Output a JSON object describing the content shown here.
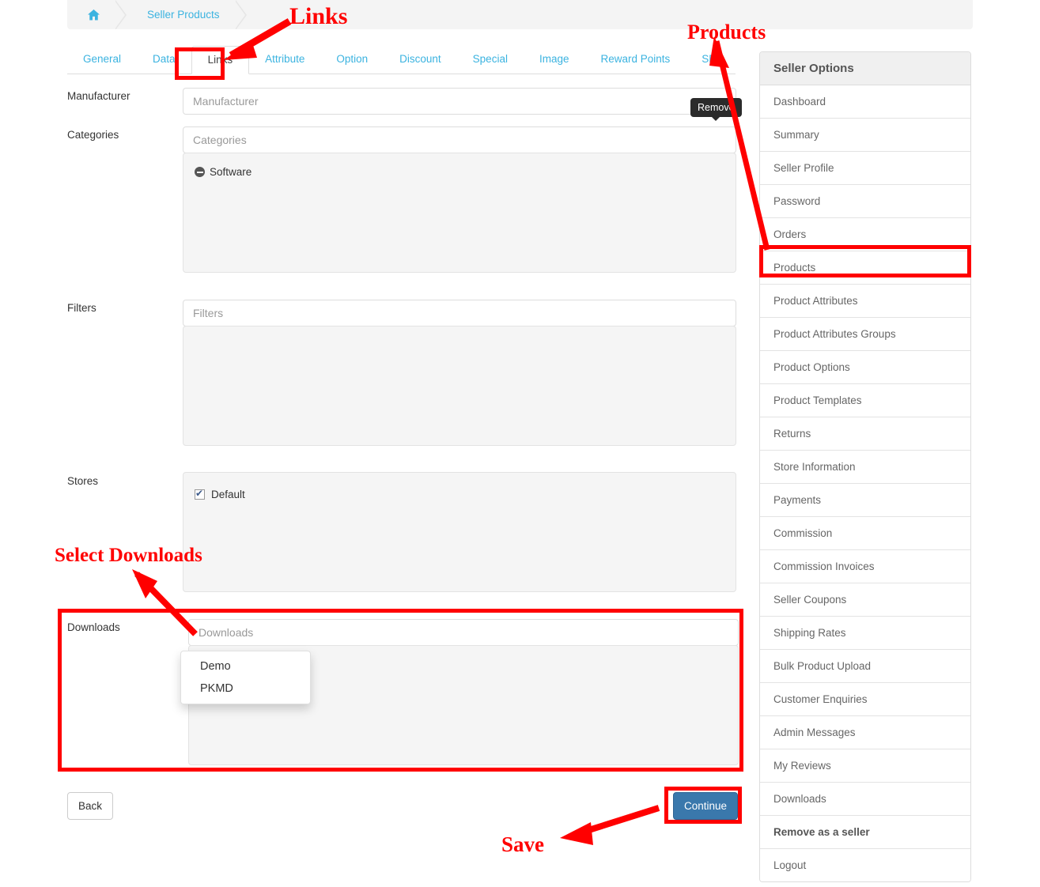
{
  "breadcrumb": {
    "home_icon": "home-icon",
    "items": [
      "Seller Products"
    ]
  },
  "tabs": [
    {
      "label": "General",
      "active": false
    },
    {
      "label": "Data",
      "active": false
    },
    {
      "label": "Links",
      "active": true
    },
    {
      "label": "Attribute",
      "active": false
    },
    {
      "label": "Option",
      "active": false
    },
    {
      "label": "Discount",
      "active": false
    },
    {
      "label": "Special",
      "active": false
    },
    {
      "label": "Image",
      "active": false
    },
    {
      "label": "Reward Points",
      "active": false
    },
    {
      "label": "SEO",
      "active": false
    }
  ],
  "form": {
    "manufacturer": {
      "label": "Manufacturer",
      "placeholder": "Manufacturer",
      "value": ""
    },
    "categories": {
      "label": "Categories",
      "placeholder": "Categories",
      "value": "",
      "selected": [
        "Software"
      ]
    },
    "filters": {
      "label": "Filters",
      "placeholder": "Filters",
      "value": "",
      "selected": []
    },
    "stores": {
      "label": "Stores",
      "options": [
        {
          "label": "Default",
          "checked": true
        }
      ]
    },
    "downloads": {
      "label": "Downloads",
      "placeholder": "Downloads",
      "value": "",
      "selected": [],
      "dropdown_options": [
        "Demo",
        "PKMD"
      ]
    }
  },
  "tooltip": {
    "remove_label": "Remove"
  },
  "buttons": {
    "back_label": "Back",
    "continue_label": "Continue"
  },
  "sidebar": {
    "title": "Seller Options",
    "items": [
      {
        "label": "Dashboard",
        "strong": false
      },
      {
        "label": "Summary",
        "strong": false
      },
      {
        "label": "Seller Profile",
        "strong": false
      },
      {
        "label": "Password",
        "strong": false
      },
      {
        "label": "Orders",
        "strong": false
      },
      {
        "label": "Products",
        "strong": false
      },
      {
        "label": "Product Attributes",
        "strong": false
      },
      {
        "label": "Product Attributes Groups",
        "strong": false
      },
      {
        "label": "Product Options",
        "strong": false
      },
      {
        "label": "Product Templates",
        "strong": false
      },
      {
        "label": "Returns",
        "strong": false
      },
      {
        "label": "Store Information",
        "strong": false
      },
      {
        "label": "Payments",
        "strong": false
      },
      {
        "label": "Commission",
        "strong": false
      },
      {
        "label": "Commission Invoices",
        "strong": false
      },
      {
        "label": "Seller Coupons",
        "strong": false
      },
      {
        "label": "Shipping Rates",
        "strong": false
      },
      {
        "label": "Bulk Product Upload",
        "strong": false
      },
      {
        "label": "Customer Enquiries",
        "strong": false
      },
      {
        "label": "Admin Messages",
        "strong": false
      },
      {
        "label": "My Reviews",
        "strong": false
      },
      {
        "label": "Downloads",
        "strong": false
      },
      {
        "label": "Remove as a seller",
        "strong": true
      },
      {
        "label": "Logout",
        "strong": false
      }
    ]
  },
  "annotations": {
    "color": "#ff0000",
    "links_label": "Links",
    "products_label": "Products",
    "select_downloads_label": "Select Downloads",
    "save_label": "Save"
  }
}
